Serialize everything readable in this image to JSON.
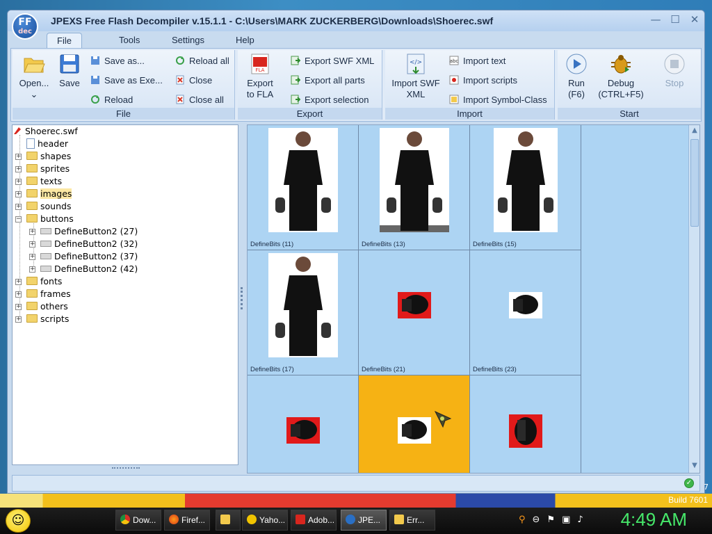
{
  "window": {
    "logo_text": "FF",
    "logo_sub": "dec",
    "title": "JPEXS Free Flash Decompiler v.15.1.1 - C:\\Users\\MARK ZUCKERBERG\\Downloads\\Shoerec.swf",
    "controls": [
      "—",
      "☐",
      "✕"
    ]
  },
  "menu": {
    "file": "File",
    "tools": "Tools",
    "settings": "Settings",
    "help": "Help"
  },
  "ribbon": {
    "file_group": {
      "caption": "File",
      "open": "Open...",
      "open_arrow": "⌄",
      "save": "Save",
      "save_as": "Save as...",
      "save_as_exe": "Save as Exe...",
      "reload": "Reload",
      "reload_all": "Reload all",
      "close": "Close",
      "close_all": "Close all"
    },
    "export_group": {
      "caption": "Export",
      "export_fla_line1": "Export",
      "export_fla_line2": "to FLA",
      "export_swf_xml": "Export SWF XML",
      "export_all_parts": "Export all parts",
      "export_selection": "Export selection"
    },
    "import_group": {
      "caption": "Import",
      "import_swf_xml_line1": "Import SWF",
      "import_swf_xml_line2": "XML",
      "import_text": "Import text",
      "import_scripts": "Import scripts",
      "import_symbol_class": "Import Symbol-Class"
    },
    "start_group": {
      "caption": "Start",
      "run_line1": "Run",
      "run_line2": "(F6)",
      "debug_line1": "Debug",
      "debug_line2": "(CTRL+F5)",
      "stop": "Stop"
    }
  },
  "tree": {
    "root": "Shoerec.swf",
    "items": [
      "header",
      "shapes",
      "sprites",
      "texts",
      "images",
      "sounds",
      "buttons"
    ],
    "buttons_children": [
      "DefineButton2 (27)",
      "DefineButton2 (32)",
      "DefineButton2 (37)",
      "DefineButton2 (42)"
    ],
    "items_after": [
      "fonts",
      "frames",
      "others",
      "scripts"
    ]
  },
  "grid": {
    "cells": [
      "DefineBits (11)",
      "DefineBits (13)",
      "DefineBits (15)",
      "DefineBits (17)",
      "DefineBits (21)",
      "DefineBits (23)",
      "",
      "",
      ""
    ]
  },
  "desktop": {
    "build": "Build 7601",
    "side_digit": "7"
  },
  "taskbar": {
    "tasks": [
      "Dow...",
      "Firef...",
      "",
      "Yaho...",
      "Adob...",
      "JPE...",
      "Err..."
    ],
    "clock": "4:49 AM"
  },
  "colors": {
    "selected_cell": "#f6b214",
    "grid_bg": "#add4f3",
    "clock": "#46e86a"
  }
}
